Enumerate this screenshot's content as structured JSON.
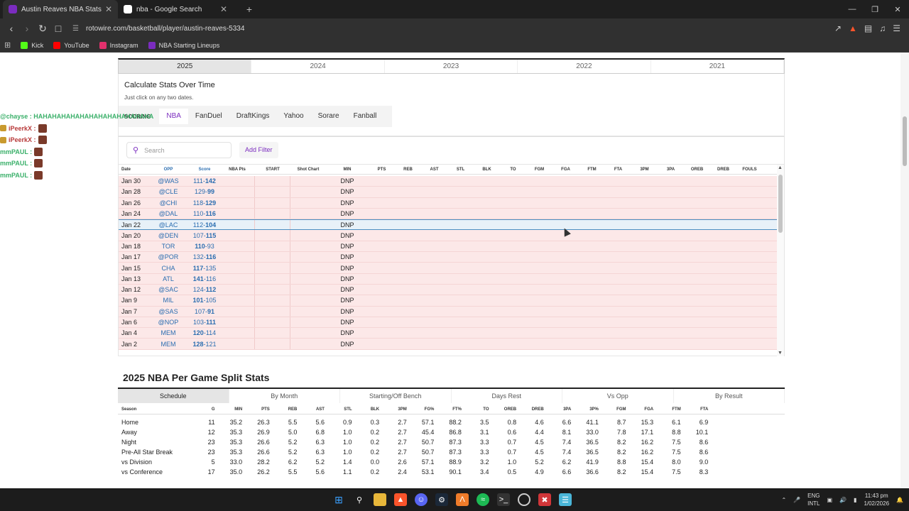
{
  "browser": {
    "tabs": [
      {
        "title": "Austin Reaves NBA Stats & News",
        "active": true,
        "favicon_color": "#7b2cbf"
      },
      {
        "title": "nba - Google Search",
        "active": false,
        "favicon_color": "#ffffff"
      }
    ],
    "url": "rotowire.com/basketball/player/austin-reaves-5334",
    "bookmarks": [
      {
        "label": "Kick",
        "color": "#53fc18"
      },
      {
        "label": "YouTube",
        "color": "#ff0000"
      },
      {
        "label": "Instagram",
        "color": "#e1306c"
      },
      {
        "label": "NBA Starting Lineups",
        "color": "#7b2cbf"
      }
    ]
  },
  "years": [
    "2025",
    "2024",
    "2023",
    "2022",
    "2021"
  ],
  "calc": {
    "title": "Calculate Stats Over Time",
    "subtitle": "Just click on any two dates.",
    "scoring_label": "SCORING",
    "scoring_options": [
      "NBA",
      "FanDuel",
      "DraftKings",
      "Yahoo",
      "Sorare",
      "Fanball"
    ]
  },
  "filters": {
    "search_placeholder": "Search",
    "add_filter": "Add Filter"
  },
  "gamelog": {
    "headers": [
      "Date",
      "OPP",
      "Score",
      "NBA Pts",
      "START",
      "Shot Chart",
      "MIN",
      "PTS",
      "REB",
      "AST",
      "STL",
      "BLK",
      "TO",
      "FGM",
      "FGA",
      "FTM",
      "FTA",
      "3PM",
      "3PA",
      "OREB",
      "DREB",
      "FOULS"
    ],
    "rows": [
      {
        "date": "Jan 30",
        "opp": "@WAS",
        "s1": "111",
        "s2": "142",
        "bold": 2,
        "min": "DNP"
      },
      {
        "date": "Jan 28",
        "opp": "@CLE",
        "s1": "129",
        "s2": "99",
        "bold": 2,
        "min": "DNP"
      },
      {
        "date": "Jan 26",
        "opp": "@CHI",
        "s1": "118",
        "s2": "129",
        "bold": 2,
        "min": "DNP"
      },
      {
        "date": "Jan 24",
        "opp": "@DAL",
        "s1": "110",
        "s2": "116",
        "bold": 2,
        "min": "DNP"
      },
      {
        "date": "Jan 22",
        "opp": "@LAC",
        "s1": "112",
        "s2": "104",
        "bold": 2,
        "min": "DNP"
      },
      {
        "date": "Jan 20",
        "opp": "@DEN",
        "s1": "107",
        "s2": "115",
        "bold": 2,
        "min": "DNP"
      },
      {
        "date": "Jan 18",
        "opp": "TOR",
        "s1": "110",
        "s2": "93",
        "bold": 1,
        "min": "DNP"
      },
      {
        "date": "Jan 17",
        "opp": "@POR",
        "s1": "132",
        "s2": "116",
        "bold": 2,
        "min": "DNP"
      },
      {
        "date": "Jan 15",
        "opp": "CHA",
        "s1": "117",
        "s2": "135",
        "bold": 1,
        "min": "DNP"
      },
      {
        "date": "Jan 13",
        "opp": "ATL",
        "s1": "141",
        "s2": "116",
        "bold": 1,
        "min": "DNP"
      },
      {
        "date": "Jan 12",
        "opp": "@SAC",
        "s1": "124",
        "s2": "112",
        "bold": 2,
        "min": "DNP"
      },
      {
        "date": "Jan 9",
        "opp": "MIL",
        "s1": "101",
        "s2": "105",
        "bold": 1,
        "min": "DNP"
      },
      {
        "date": "Jan 7",
        "opp": "@SAS",
        "s1": "107",
        "s2": "91",
        "bold": 2,
        "min": "DNP"
      },
      {
        "date": "Jan 6",
        "opp": "@NOP",
        "s1": "103",
        "s2": "111",
        "bold": 2,
        "min": "DNP"
      },
      {
        "date": "Jan 4",
        "opp": "MEM",
        "s1": "120",
        "s2": "114",
        "bold": 1,
        "min": "DNP"
      },
      {
        "date": "Jan 2",
        "opp": "MEM",
        "s1": "128",
        "s2": "121",
        "bold": 1,
        "min": "DNP"
      }
    ]
  },
  "splits": {
    "title": "2025 NBA Per Game Split Stats",
    "tabs": [
      "Schedule",
      "By Month",
      "Starting/Off Bench",
      "Days Rest",
      "Vs Opp",
      "By Result"
    ],
    "headers": [
      "Season",
      "G",
      "MIN",
      "PTS",
      "REB",
      "AST",
      "STL",
      "BLK",
      "3PM",
      "FG%",
      "FT%",
      "TO",
      "OREB",
      "DREB",
      "3PA",
      "3P%",
      "FGM",
      "FGA",
      "FTM",
      "FTA"
    ],
    "rows": [
      [
        "Home",
        "11",
        "35.2",
        "26.3",
        "5.5",
        "5.6",
        "0.9",
        "0.3",
        "2.7",
        "57.1",
        "88.2",
        "3.5",
        "0.8",
        "4.6",
        "6.6",
        "41.1",
        "8.7",
        "15.3",
        "6.1",
        "6.9"
      ],
      [
        "Away",
        "12",
        "35.3",
        "26.9",
        "5.0",
        "6.8",
        "1.0",
        "0.2",
        "2.7",
        "45.4",
        "86.8",
        "3.1",
        "0.6",
        "4.4",
        "8.1",
        "33.0",
        "7.8",
        "17.1",
        "8.8",
        "10.1"
      ],
      [
        "Night",
        "23",
        "35.3",
        "26.6",
        "5.2",
        "6.3",
        "1.0",
        "0.2",
        "2.7",
        "50.7",
        "87.3",
        "3.3",
        "0.7",
        "4.5",
        "7.4",
        "36.5",
        "8.2",
        "16.2",
        "7.5",
        "8.6"
      ],
      [
        "Pre-All Star Break",
        "23",
        "35.3",
        "26.6",
        "5.2",
        "6.3",
        "1.0",
        "0.2",
        "2.7",
        "50.7",
        "87.3",
        "3.3",
        "0.7",
        "4.5",
        "7.4",
        "36.5",
        "8.2",
        "16.2",
        "7.5",
        "8.6"
      ],
      [
        "vs Division",
        "5",
        "33.0",
        "28.2",
        "6.2",
        "5.2",
        "1.4",
        "0.0",
        "2.6",
        "57.1",
        "88.9",
        "3.2",
        "1.0",
        "5.2",
        "6.2",
        "41.9",
        "8.8",
        "15.4",
        "8.0",
        "9.0"
      ],
      [
        "vs Conference",
        "17",
        "35.0",
        "26.2",
        "5.5",
        "5.6",
        "1.1",
        "0.2",
        "2.4",
        "53.1",
        "90.1",
        "3.4",
        "0.5",
        "4.9",
        "6.6",
        "36.6",
        "8.2",
        "15.4",
        "7.5",
        "8.3"
      ]
    ]
  },
  "chat_overlay": [
    {
      "name": "@chayse : HAHAHAHAHAHAHAHAHAHAHAHAHA",
      "color": "#3bb06a",
      "badge": false,
      "emote": false
    },
    {
      "name": "iPeerkX :",
      "color": "#b83a3a",
      "badge": true,
      "emote": true
    },
    {
      "name": "iPeerkX :",
      "color": "#b83a3a",
      "badge": true,
      "emote": true
    },
    {
      "name": "mmPAUL :",
      "color": "#3bb06a",
      "badge": false,
      "emote": true
    },
    {
      "name": "mmPAUL :",
      "color": "#3bb06a",
      "badge": false,
      "emote": true
    },
    {
      "name": "mmPAUL :",
      "color": "#3bb06a",
      "badge": false,
      "emote": true
    }
  ],
  "taskbar": {
    "lang1": "ENG",
    "lang2": "INTL",
    "time": "11:43 pm",
    "date": "1/02/2026"
  }
}
